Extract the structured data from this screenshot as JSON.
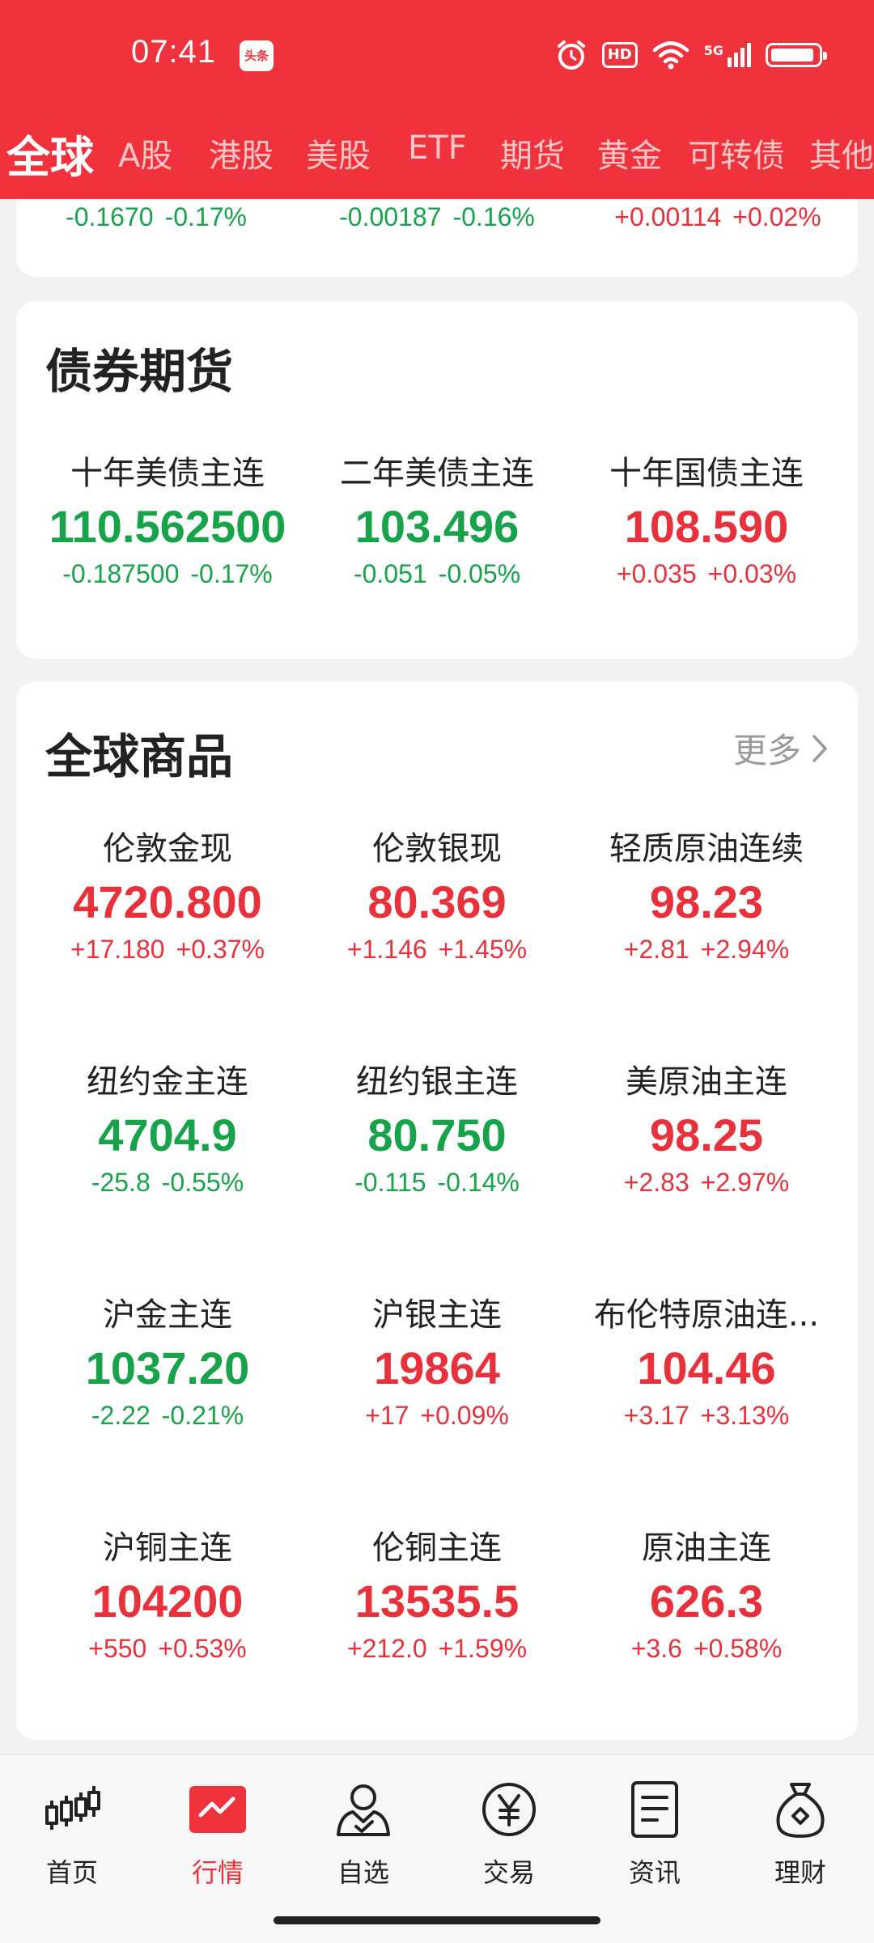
{
  "status_bar": {
    "time": "07:41",
    "app_badge": "头条",
    "hd": "HD",
    "network": "5G"
  },
  "tabs": [
    {
      "label": "全球",
      "active": true
    },
    {
      "label": "A股"
    },
    {
      "label": "港股"
    },
    {
      "label": "美股"
    },
    {
      "label": "ETF"
    },
    {
      "label": "期货"
    },
    {
      "label": "黄金"
    },
    {
      "label": "可转债"
    },
    {
      "label": "其他"
    }
  ],
  "partial_row": [
    {
      "change": "-0.1670",
      "pct": "-0.17%",
      "dir": "down"
    },
    {
      "change": "-0.00187",
      "pct": "-0.16%",
      "dir": "down"
    },
    {
      "change": "+0.00114",
      "pct": "+0.02%",
      "dir": "up"
    }
  ],
  "bond_futures": {
    "title": "债券期货",
    "items": [
      {
        "name": "十年美债主连",
        "price": "110.562500",
        "change": "-0.187500",
        "pct": "-0.17%",
        "dir": "down"
      },
      {
        "name": "二年美债主连",
        "price": "103.496",
        "change": "-0.051",
        "pct": "-0.05%",
        "dir": "down"
      },
      {
        "name": "十年国债主连",
        "price": "108.590",
        "change": "+0.035",
        "pct": "+0.03%",
        "dir": "up"
      }
    ]
  },
  "global_commodities": {
    "title": "全球商品",
    "more": "更多",
    "items": [
      {
        "name": "伦敦金现",
        "price": "4720.800",
        "change": "+17.180",
        "pct": "+0.37%",
        "dir": "up"
      },
      {
        "name": "伦敦银现",
        "price": "80.369",
        "change": "+1.146",
        "pct": "+1.45%",
        "dir": "up"
      },
      {
        "name": "轻质原油连续",
        "price": "98.23",
        "change": "+2.81",
        "pct": "+2.94%",
        "dir": "up"
      },
      {
        "name": "纽约金主连",
        "price": "4704.9",
        "change": "-25.8",
        "pct": "-0.55%",
        "dir": "down"
      },
      {
        "name": "纽约银主连",
        "price": "80.750",
        "change": "-0.115",
        "pct": "-0.14%",
        "dir": "down"
      },
      {
        "name": "美原油主连",
        "price": "98.25",
        "change": "+2.83",
        "pct": "+2.97%",
        "dir": "up"
      },
      {
        "name": "沪金主连",
        "price": "1037.20",
        "change": "-2.22",
        "pct": "-0.21%",
        "dir": "down"
      },
      {
        "name": "沪银主连",
        "price": "19864",
        "change": "+17",
        "pct": "+0.09%",
        "dir": "up"
      },
      {
        "name": "布伦特原油连...",
        "price": "104.46",
        "change": "+3.17",
        "pct": "+3.13%",
        "dir": "up"
      },
      {
        "name": "沪铜主连",
        "price": "104200",
        "change": "+550",
        "pct": "+0.53%",
        "dir": "up"
      },
      {
        "name": "伦铜主连",
        "price": "13535.5",
        "change": "+212.0",
        "pct": "+1.59%",
        "dir": "up"
      },
      {
        "name": "原油主连",
        "price": "626.3",
        "change": "+3.6",
        "pct": "+0.58%",
        "dir": "up"
      }
    ]
  },
  "bottom_nav": [
    {
      "label": "首页",
      "icon": "candlestick-icon"
    },
    {
      "label": "行情",
      "icon": "market-chart-icon",
      "active": true
    },
    {
      "label": "自选",
      "icon": "user-check-icon"
    },
    {
      "label": "交易",
      "icon": "yen-circle-icon"
    },
    {
      "label": "资讯",
      "icon": "news-doc-icon"
    },
    {
      "label": "理财",
      "icon": "money-bag-icon"
    }
  ],
  "colors": {
    "brand_red": "#f0323c",
    "up": "#e8313b",
    "down": "#16a34a"
  }
}
